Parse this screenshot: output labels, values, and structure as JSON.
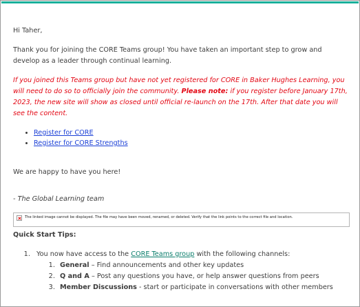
{
  "email": {
    "greeting": "Hi Taher,",
    "intro": "Thank you for joining the CORE Teams group! You have taken an important step to grow and develop as a leader through continual learning.",
    "warning": {
      "part1": "If you joined this Teams group but have not yet registered for CORE in Baker Hughes Learning, you will need to do so to officially join the community. ",
      "note_label": "Please note:",
      "part2": " if you register before January 17th, 2023, the new site will show as closed until official re-launch on the 17th. After that date you will see the content."
    },
    "links": [
      {
        "label": "Register for CORE"
      },
      {
        "label": "Register for CORE Strengths"
      }
    ],
    "happy": "We are happy to have you here!",
    "signature": "- The Global Learning team",
    "broken_image_text": "The linked image cannot be displayed.  The file may have been moved, renamed, or deleted. Verify that the link points to the correct file and location.",
    "tips": {
      "title": "Quick Start Tips:",
      "item1_prefix": "You now have access to the ",
      "item1_link": "CORE Teams group",
      "item1_suffix": " with the following channels:",
      "channels": [
        {
          "name": "General",
          "desc": " – Find announcements and other key updates"
        },
        {
          "name": "Q and A",
          "desc": " – Post any questions you have, or help answer questions from peers"
        },
        {
          "name": "Member Discussions",
          "desc": " - start or participate in conversations with other members"
        }
      ]
    }
  },
  "colors": {
    "accent_bar": "#19b09b",
    "warning_text": "#e30613",
    "link": "#1a3fd6"
  }
}
